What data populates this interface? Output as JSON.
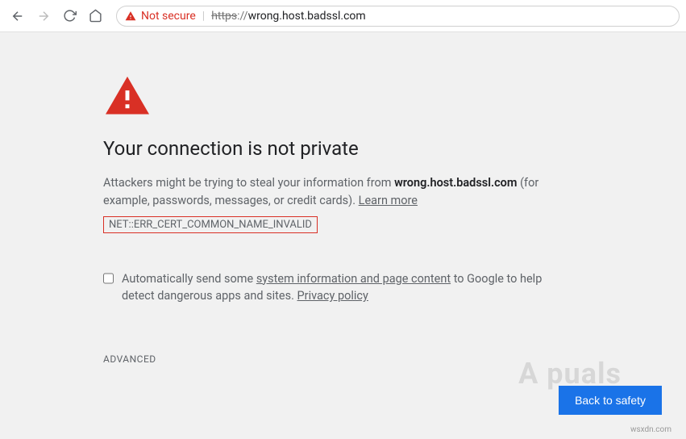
{
  "toolbar": {
    "not_secure_label": "Not secure",
    "url_https": "https",
    "url_sep": "://",
    "url_host": "wrong.host.badssl.com"
  },
  "page": {
    "heading": "Your connection is not private",
    "desc_prefix": "Attackers might be trying to steal your information from ",
    "desc_host": "wrong.host.badssl.com",
    "desc_suffix": " (for example, passwords, messages, or credit cards). ",
    "learn_more": "Learn more",
    "error_code": "NET::ERR_CERT_COMMON_NAME_INVALID",
    "optin_prefix": "Automatically send some ",
    "optin_link": "system information and page content",
    "optin_suffix": " to Google to help detect dangerous apps and sites. ",
    "privacy": "Privacy policy",
    "advanced": "ADVANCED",
    "back_to_safety": "Back to safety"
  },
  "branding": {
    "watermark": "wsxdn.com",
    "logo_text": "A  puals"
  }
}
